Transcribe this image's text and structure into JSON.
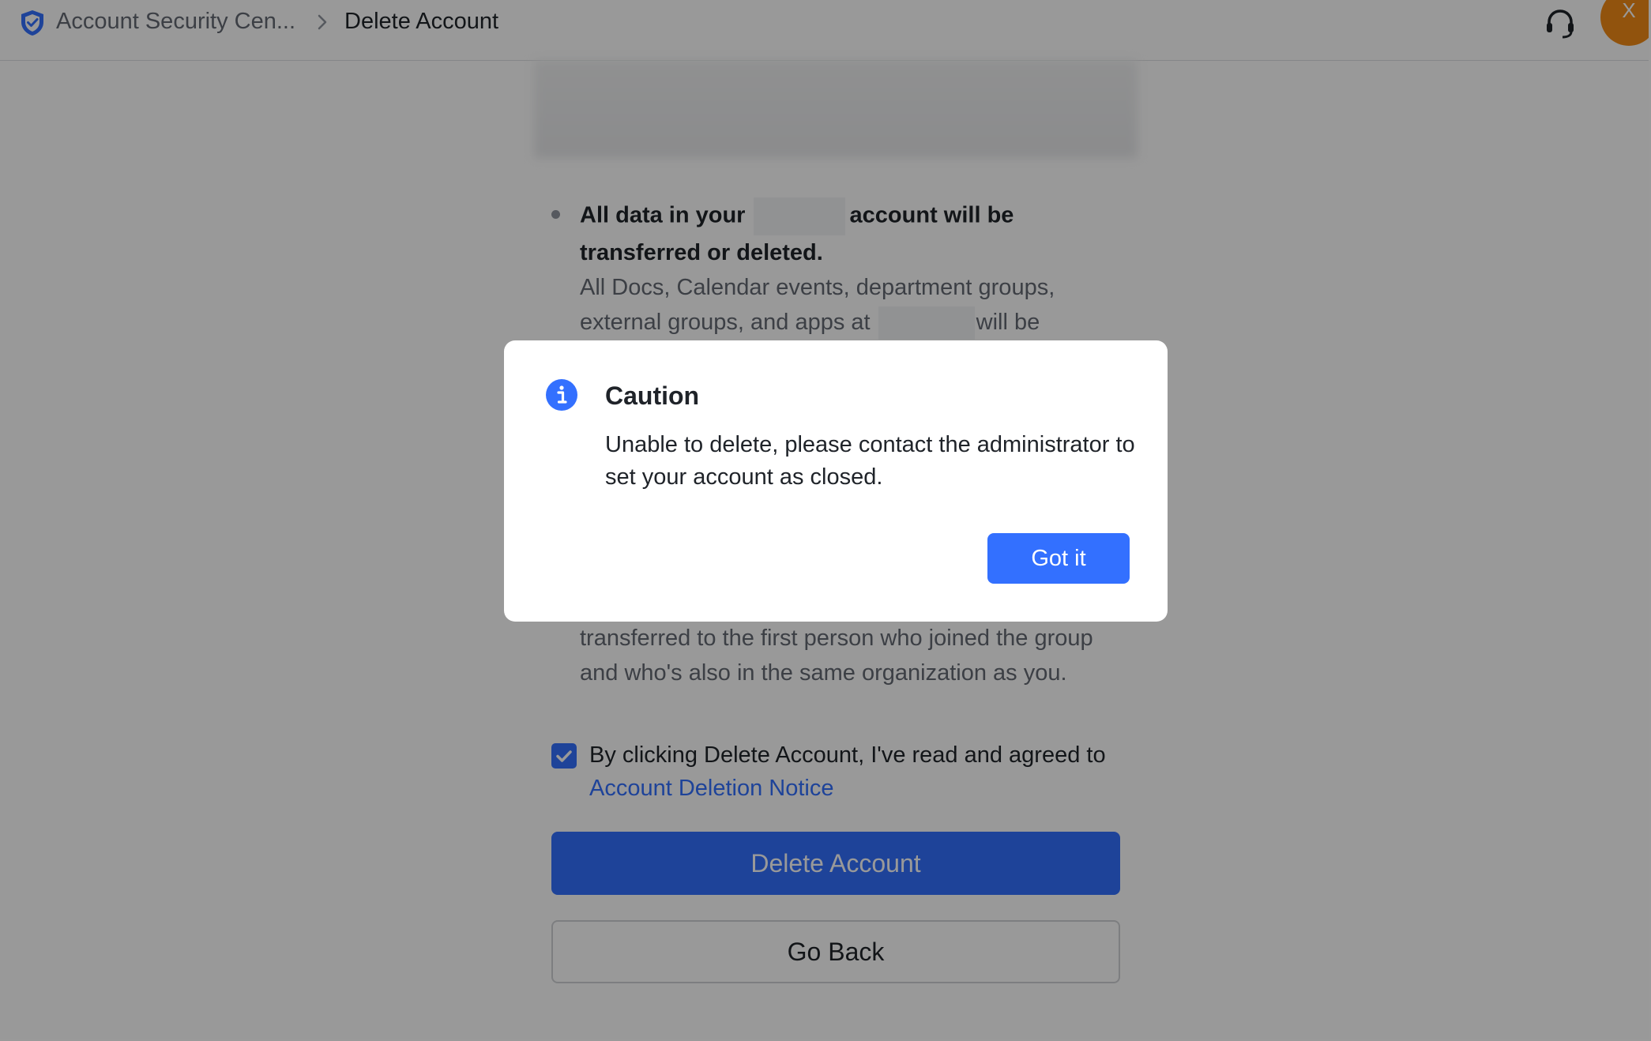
{
  "header": {
    "breadcrumb": [
      "Account Security Cen...",
      "Delete Account"
    ],
    "avatar_initial": "X",
    "icons": [
      "shield-icon",
      "chevron-right-icon",
      "headset-icon"
    ]
  },
  "notice": {
    "item1_title_a": "All data in your",
    "item1_title_b": "account will be transferred or deleted.",
    "item1_desc_a": "All Docs, Calendar events, department groups, external groups, and apps at",
    "item1_desc_b": "will be",
    "item2_desc": "transferred to the first person who joined the group and who's also in the same organization as you."
  },
  "agreement": {
    "checked": true,
    "text": "By clicking Delete Account, I've read and agreed to",
    "link": "Account Deletion Notice"
  },
  "actions": {
    "delete_label": "Delete Account",
    "back_label": "Go Back"
  },
  "modal": {
    "title": "Caution",
    "message": "Unable to delete, please contact the administrator to set your account as closed.",
    "confirm_label": "Got it",
    "icon": "info-icon"
  },
  "colors": {
    "accent": "#3370ff",
    "avatar": "#f28b16",
    "text": "#1f2329",
    "secondary_text": "#646a73"
  }
}
